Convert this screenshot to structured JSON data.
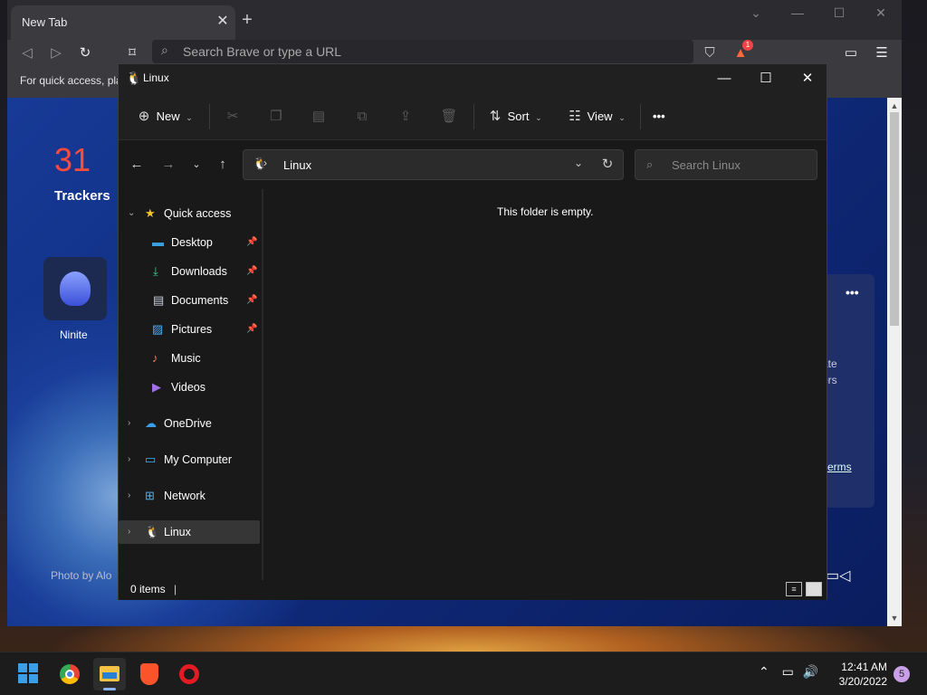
{
  "browser": {
    "tab_title": "New Tab",
    "tab_close": "✕",
    "new_tab": "+",
    "omnibox_placeholder": "Search Brave or type a URL",
    "bookmarks_hint": "For quick access, pla",
    "rewards_badge": "1",
    "window_controls": {
      "chevron": "⌄",
      "minimize": "—",
      "maximize": "☐",
      "close": "✕"
    }
  },
  "new_tab_page": {
    "trackers_count": "31",
    "trackers_label": "Trackers",
    "tile_label": "Ninite",
    "card_dots": "•••",
    "card_text_1": "ate",
    "card_text_2": "ors",
    "card_terms": "erms",
    "photo_credit": "Photo by Alo"
  },
  "explorer": {
    "title": "Linux",
    "commands": {
      "new": "New",
      "sort": "Sort",
      "view": "View",
      "more": "•••"
    },
    "address": {
      "path": "Linux"
    },
    "search": {
      "placeholder": "Search Linux"
    },
    "sidebar": {
      "quick_access": "Quick access",
      "items": [
        {
          "label": "Desktop",
          "icon": "desktop-icon",
          "pinned": true
        },
        {
          "label": "Downloads",
          "icon": "download-icon",
          "pinned": true
        },
        {
          "label": "Documents",
          "icon": "documents-icon",
          "pinned": true
        },
        {
          "label": "Pictures",
          "icon": "pictures-icon",
          "pinned": true
        },
        {
          "label": "Music",
          "icon": "music-icon",
          "pinned": false
        },
        {
          "label": "Videos",
          "icon": "videos-icon",
          "pinned": false
        }
      ],
      "onedrive": "OneDrive",
      "my_computer": "My Computer",
      "network": "Network",
      "linux": "Linux"
    },
    "empty_message": "This folder is empty.",
    "status": {
      "items": "0 items"
    }
  },
  "taskbar": {
    "apps": [
      "start",
      "chrome",
      "file-explorer",
      "brave",
      "opera"
    ],
    "time": "12:41 AM",
    "date": "3/20/2022",
    "notification_count": "5"
  },
  "colors": {
    "explorer_bg": "#191919",
    "selected_nav": "#363636",
    "brave_accent": "#ff4b3e",
    "taskbar_bg": "#1c1c1c"
  }
}
